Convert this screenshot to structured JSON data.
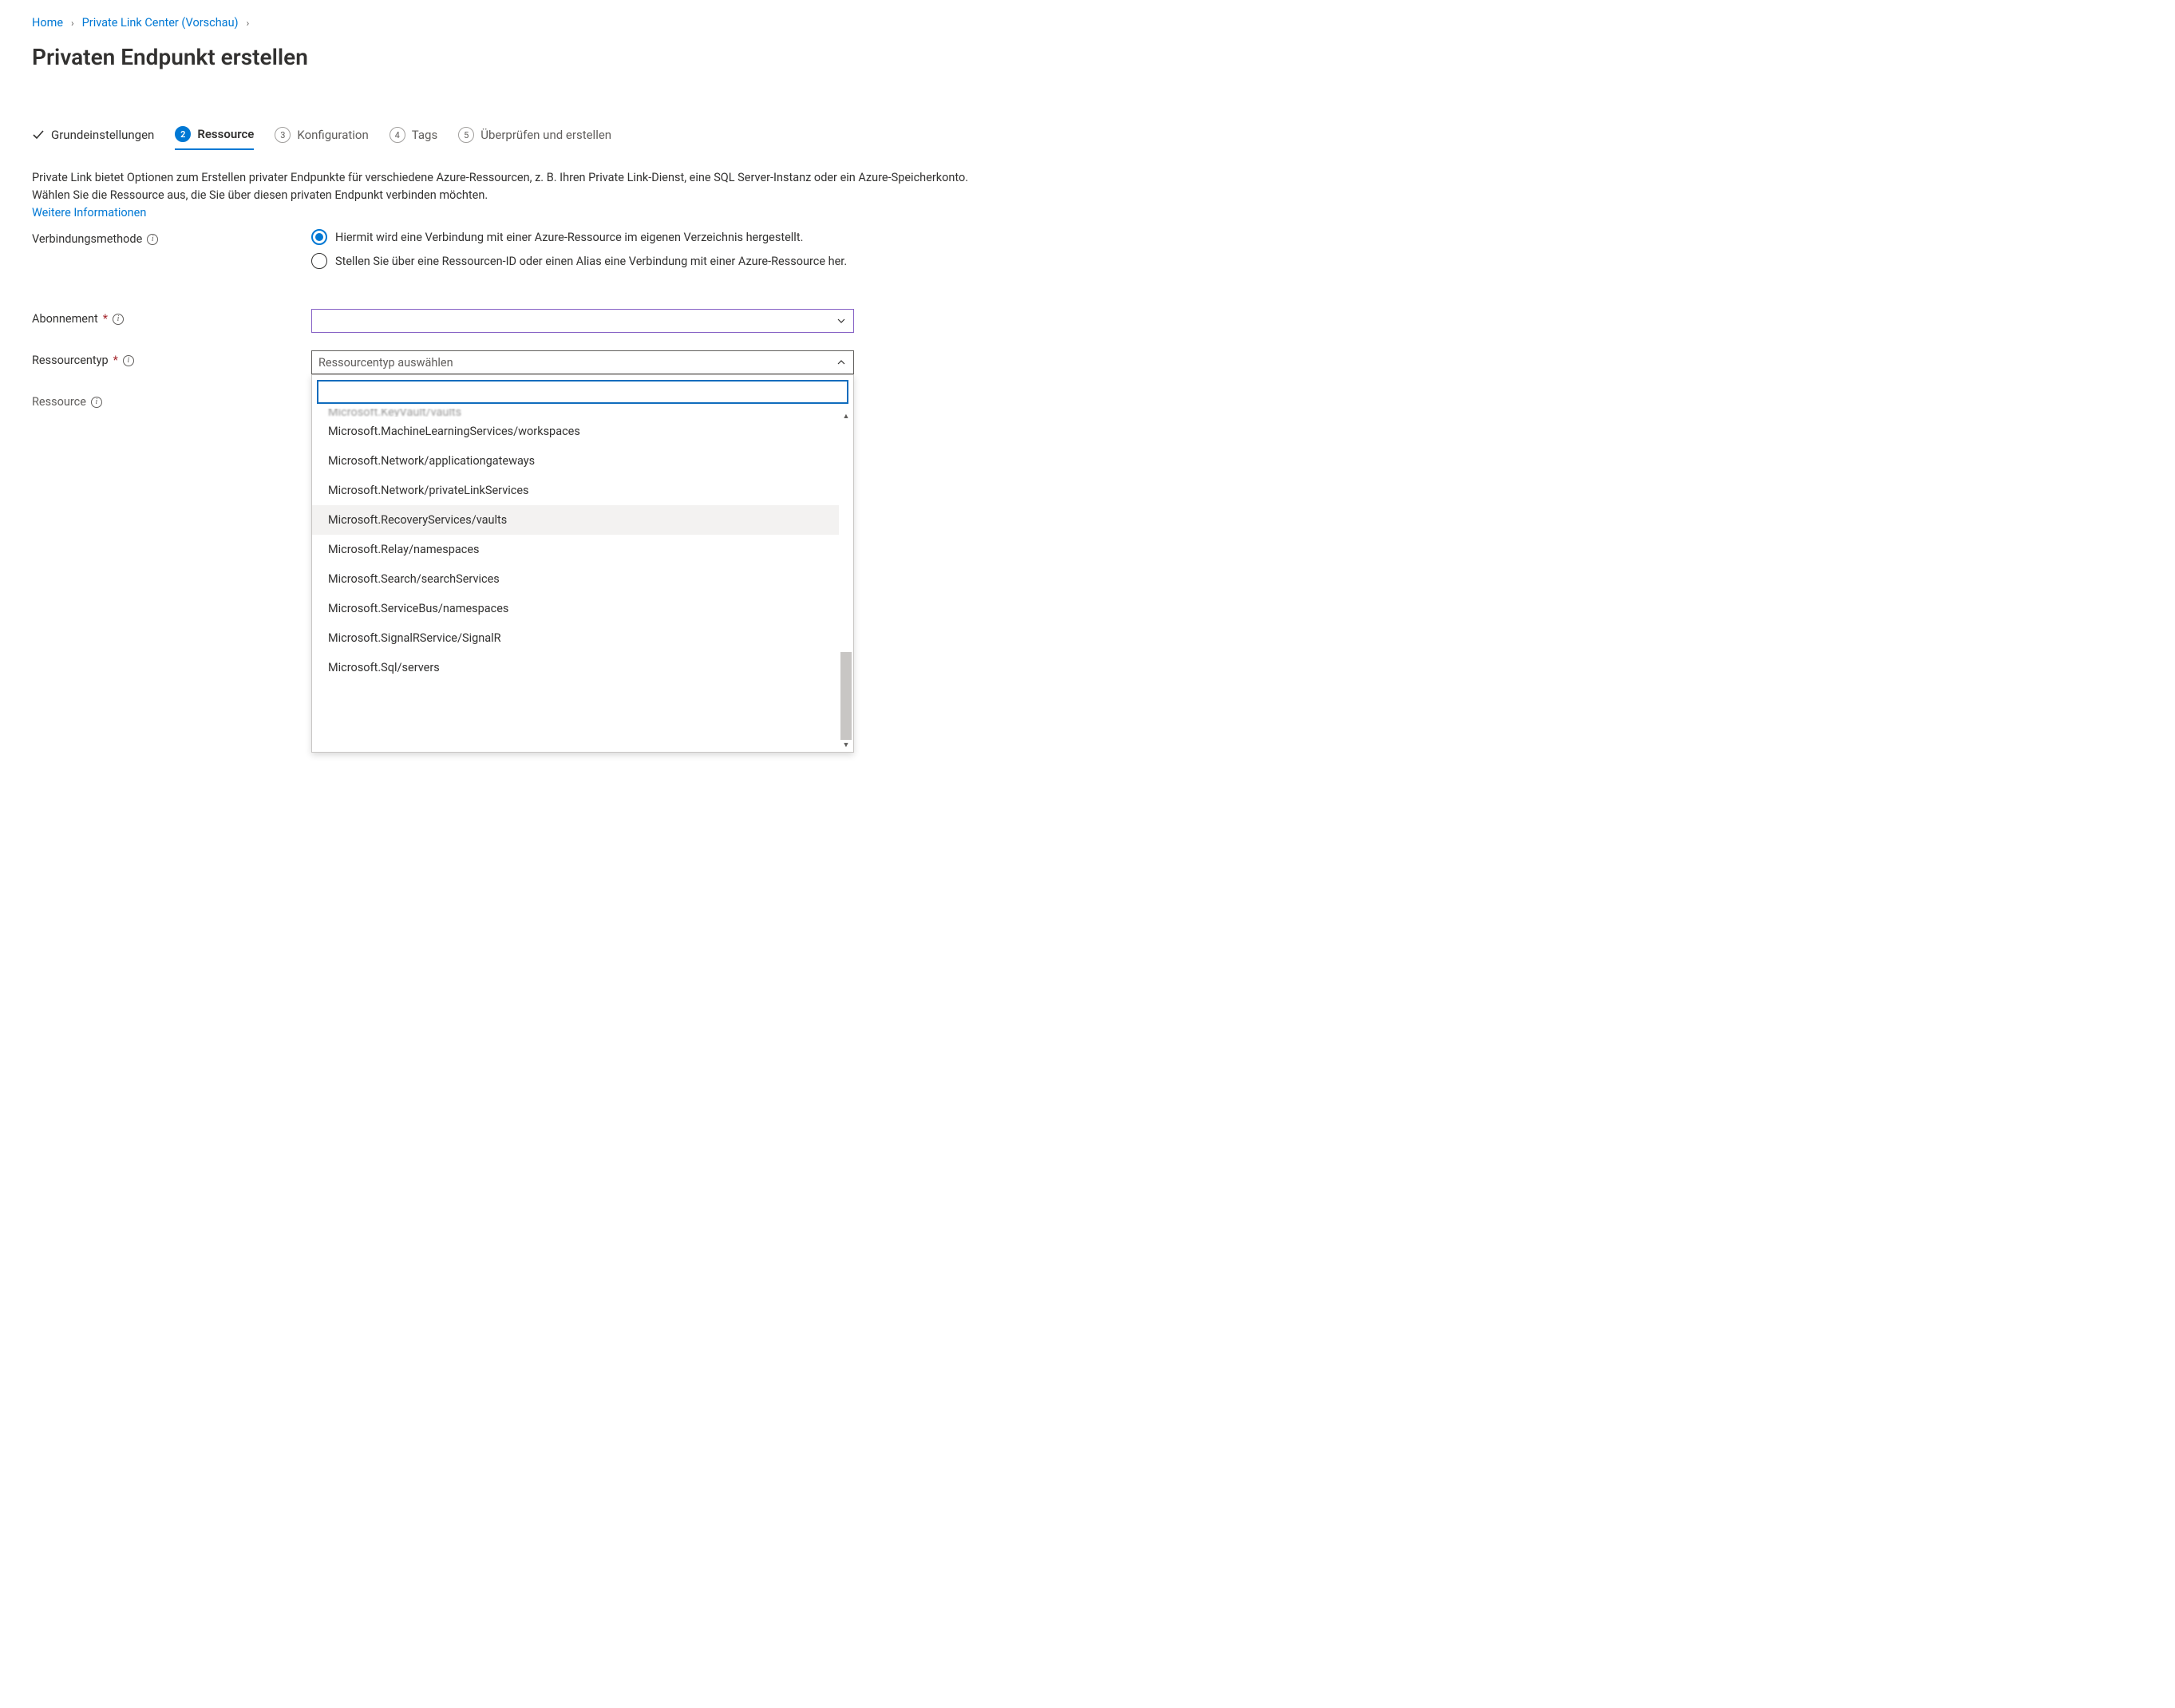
{
  "breadcrumb": {
    "home": "Home",
    "plc": "Private Link Center (Vorschau)"
  },
  "page_title": "Privaten Endpunkt erstellen",
  "tabs": {
    "basics": "Grundeinstellungen",
    "resource": "Ressource",
    "config": "Konfiguration",
    "tags": "Tags",
    "review": "Überprüfen und erstellen",
    "step2": "2",
    "step3": "3",
    "step4": "4",
    "step5": "5"
  },
  "intro": {
    "text": "Private Link bietet Optionen zum Erstellen privater Endpunkte für verschiedene Azure-Ressourcen, z. B. Ihren Private Link-Dienst, eine SQL Server-Instanz oder ein Azure-Speicherkonto. Wählen Sie die Ressource aus, die Sie über diesen privaten Endpunkt verbinden möchten.",
    "link": "Weitere Informationen"
  },
  "labels": {
    "connection_method": "Verbindungsmethode",
    "subscription": "Abonnement",
    "resource_type": "Ressourcentyp",
    "resource": "Ressource"
  },
  "radios": {
    "own_directory": "Hiermit wird eine Verbindung mit einer Azure-Ressource im eigenen Verzeichnis hergestellt.",
    "by_id": "Stellen Sie über eine Ressourcen-ID oder einen Alias eine Verbindung mit einer Azure-Ressource her."
  },
  "selects": {
    "resource_type_placeholder": "Ressourcentyp auswählen"
  },
  "dropdown": {
    "cutoff": "Microsoft.KeyVault/vaults",
    "items": [
      "Microsoft.MachineLearningServices/workspaces",
      "Microsoft.Network/applicationgateways",
      "Microsoft.Network/privateLinkServices",
      "Microsoft.RecoveryServices/vaults",
      "Microsoft.Relay/namespaces",
      "Microsoft.Search/searchServices",
      "Microsoft.ServiceBus/namespaces",
      "Microsoft.SignalRService/SignalR",
      "Microsoft.Sql/servers"
    ],
    "highlighted_index": 3
  }
}
